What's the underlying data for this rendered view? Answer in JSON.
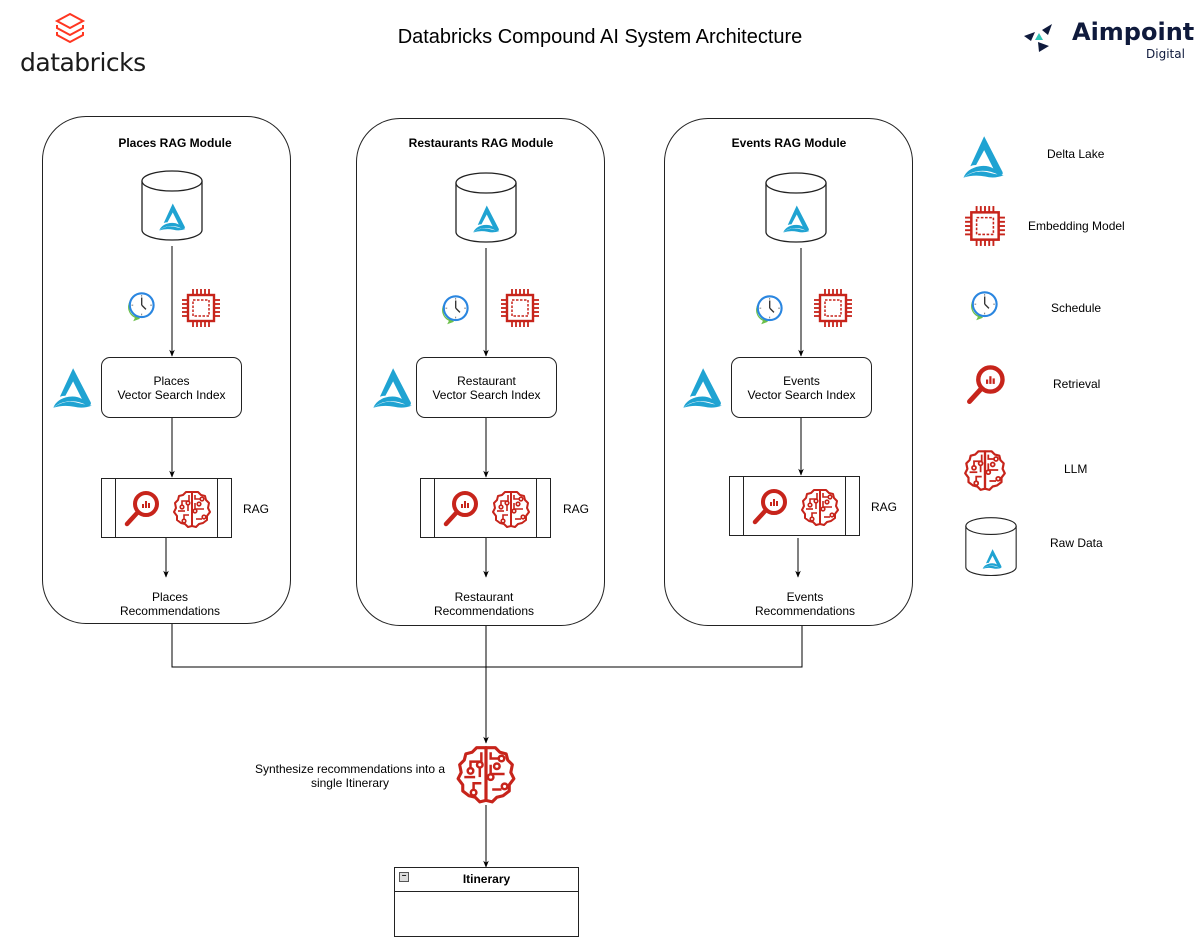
{
  "header": {
    "title": "Databricks Compound AI System Architecture",
    "left_logo": {
      "icon": "databricks-stack-icon",
      "text": "databricks",
      "color": "#ff3621"
    },
    "right_logo": {
      "icon": "aimpoint-arrows-icon",
      "text": "Aimpoint",
      "subtext": "Digital",
      "color": "#0f1a3c",
      "accent": "#2ec4b6"
    }
  },
  "modules": [
    {
      "title": "Places RAG Module",
      "index_label_line1": "Places",
      "index_label_line2": "Vector Search Index",
      "rag_label": "RAG",
      "output_line1": "Places",
      "output_line2": "Recommendations"
    },
    {
      "title": "Restaurants RAG Module",
      "index_label_line1": "Restaurant",
      "index_label_line2": "Vector Search Index",
      "rag_label": "RAG",
      "output_line1": "Restaurant",
      "output_line2": "Recommendations"
    },
    {
      "title": "Events RAG Module",
      "index_label_line1": "Events",
      "index_label_line2": "Vector Search Index",
      "rag_label": "RAG",
      "output_line1": "Events",
      "output_line2": "Recommendations"
    }
  ],
  "synthesis": {
    "label_line1": "Synthesize recommendations into a",
    "label_line2": "single Itinerary",
    "icon": "llm-brain-icon"
  },
  "itinerary": {
    "title": "Itinerary"
  },
  "legend": [
    {
      "icon": "delta-lake-icon",
      "label": "Delta Lake"
    },
    {
      "icon": "embedding-chip-icon",
      "label": "Embedding Model"
    },
    {
      "icon": "schedule-clock-icon",
      "label": "Schedule"
    },
    {
      "icon": "retrieval-magnifier-icon",
      "label": "Retrieval"
    },
    {
      "icon": "llm-brain-icon",
      "label": "LLM"
    },
    {
      "icon": "raw-data-cylinder-icon",
      "label": "Raw Data"
    }
  ],
  "colors": {
    "delta": "#1fa3d2",
    "aws_red": "#c7241b",
    "clock_blue": "#2a86e0",
    "clock_green": "#6cc04a",
    "databricks": "#ff3621"
  }
}
